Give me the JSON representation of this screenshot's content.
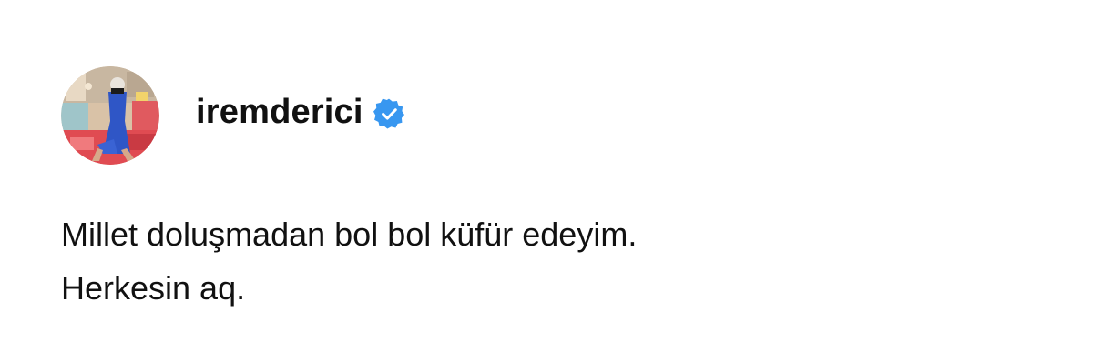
{
  "post": {
    "username": "iremderici",
    "verified": true,
    "verified_badge_color": "#3897f0",
    "avatar_icon": "profile-photo",
    "text_lines": [
      "Millet doluşmadan bol bol küfür edeyim.",
      "Herkesin aq."
    ]
  }
}
